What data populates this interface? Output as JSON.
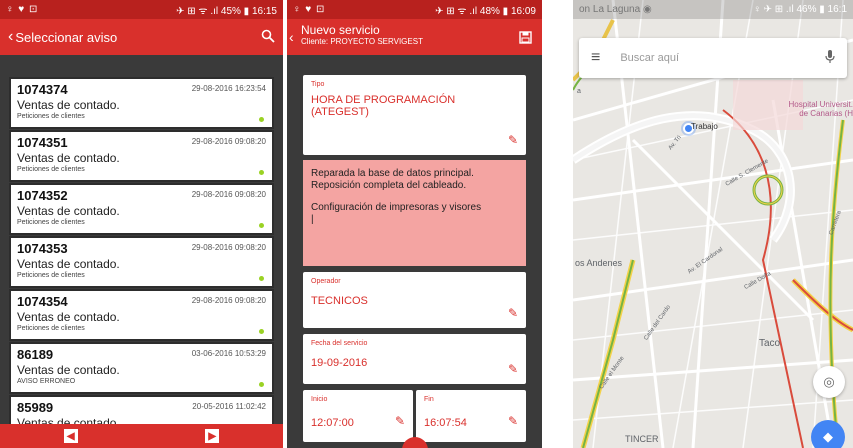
{
  "phone1": {
    "status": {
      "left": "♀ ♥ ⊡",
      "right": "✈ ⊞ ᯤ .ıl 45% ▮ 16:15"
    },
    "appbar": {
      "back": "‹",
      "title": "Seleccionar aviso",
      "search_icon": "search-icon"
    },
    "cards": [
      {
        "num": "1074374",
        "date": "29-08-2016 16:23:54",
        "desc": "Ventas de contado.",
        "sub": "Peticiones de clientes"
      },
      {
        "num": "1074351",
        "date": "29-08-2016 09:08:20",
        "desc": "Ventas de contado.",
        "sub": "Peticiones de clientes"
      },
      {
        "num": "1074352",
        "date": "29-08-2016 09:08:20",
        "desc": "Ventas de contado.",
        "sub": "Peticiones de clientes"
      },
      {
        "num": "1074353",
        "date": "29-08-2016 09:08:20",
        "desc": "Ventas de contado.",
        "sub": "Peticiones de clientes"
      },
      {
        "num": "1074354",
        "date": "29-08-2016 09:08:20",
        "desc": "Ventas de contado.",
        "sub": "Peticiones de clientes"
      },
      {
        "num": "86189",
        "date": "03-06-2016 10:53:29",
        "desc": "Ventas de contado.",
        "sub": "AVISO ERRONEO"
      },
      {
        "num": "85989",
        "date": "20-05-2016 11:02:42",
        "desc": "Ventas de contado.",
        "sub": ""
      }
    ],
    "bottom": {
      "prev": "◀",
      "next": "▶"
    }
  },
  "phone2": {
    "status": {
      "left": "♀ ♥ ⊡",
      "right": "✈ ⊞ ᯤ .ıl 48% ▮ 16:09"
    },
    "appbar": {
      "back": "‹",
      "title": "Nuevo servicio",
      "subtitle": "Cliente: PROYECTO SERVIGEST",
      "save": "💾"
    },
    "tipo": {
      "label": "Tipo",
      "value": "HORA DE PROGRAMACIÓN (ATEGEST)"
    },
    "notes": {
      "line1": "Reparada la base de datos principal. Reposición completa del cableado.",
      "line2": "Configuración de impresoras y visores",
      "cursor": "|"
    },
    "operador": {
      "label": "Operador",
      "value": "TECNICOS"
    },
    "fecha": {
      "label": "Fecha del servicio",
      "value": "19-09-2016"
    },
    "inicio": {
      "label": "Inicio",
      "value": "12:07:00"
    },
    "fin": {
      "label": "Fin",
      "value": "16:07:54"
    },
    "edit_icon": "✎"
  },
  "phone3": {
    "status": {
      "left": "on La Laguna ◉",
      "right": "♀ ✈ ⊞ .ıl 46% ▮ 16:1"
    },
    "search": {
      "menu": "≡",
      "placeholder": "Buscar aquí",
      "mic": "🎙"
    },
    "labels": {
      "trabajo": "Trabajo",
      "hospital": "Hospital Universit. de Canarias (H",
      "andenes": "os Andenes",
      "taco": "Taco",
      "tincer": "TINCER",
      "calle_clemente": "Calle S. Clemente",
      "av_cardonal": "Av. El Cardonal",
      "calle_dona": "Calle Doña",
      "calle_cardo": "Calle del Cardo",
      "calle_monte": "Calle el Monte",
      "carretera": "Carretera",
      "av_tri": "Av. Tri",
      "road_a": "a"
    },
    "loc_icon": "◎",
    "dir_icon": "◆"
  }
}
